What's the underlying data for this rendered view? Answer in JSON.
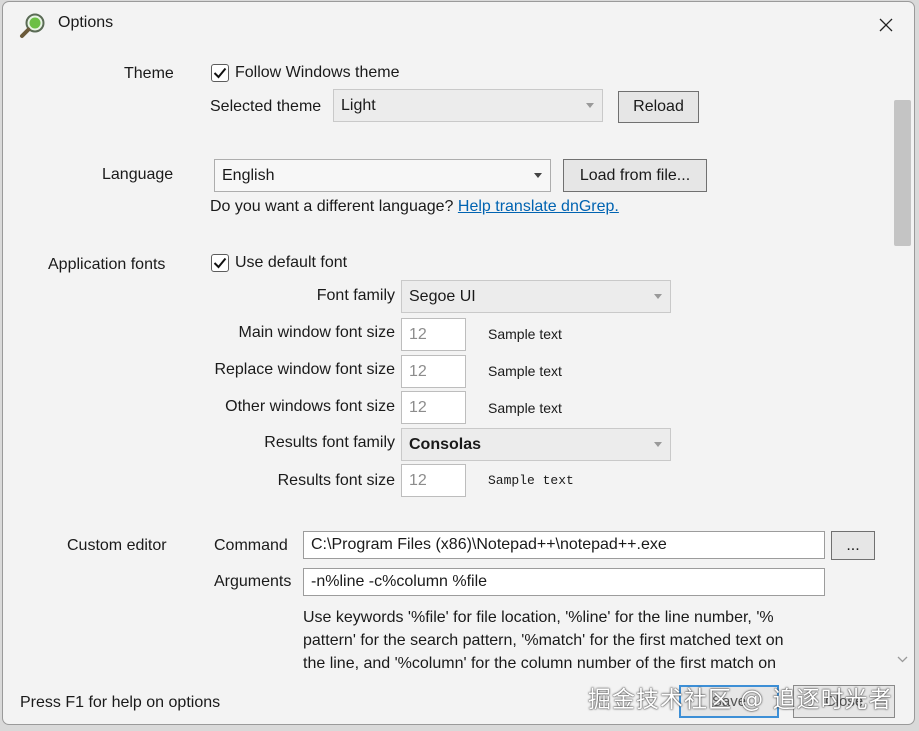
{
  "window": {
    "title": "Options",
    "app_icon": "magnifier-icon",
    "close_icon": "close-icon"
  },
  "theme": {
    "label": "Theme",
    "follow_windows": {
      "label": "Follow Windows theme",
      "checked": true
    },
    "selected_label": "Selected theme",
    "selected_value": "Light",
    "reload_label": "Reload"
  },
  "language": {
    "label": "Language",
    "value": "English",
    "load_label": "Load from file...",
    "prompt": "Do you want a different language?",
    "help_link": "Help translate dnGrep."
  },
  "fonts": {
    "label": "Application fonts",
    "use_default": {
      "label": "Use default font",
      "checked": true
    },
    "family_label": "Font family",
    "family_value": "Segoe UI",
    "main_label": "Main window font size",
    "main_value": "12",
    "replace_label": "Replace window font size",
    "replace_value": "12",
    "other_label": "Other windows font size",
    "other_value": "12",
    "sample_text": "Sample text",
    "results_family_label": "Results font family",
    "results_family_value": "Consolas",
    "results_size_label": "Results font size",
    "results_size_value": "12"
  },
  "editor": {
    "label": "Custom editor",
    "command_label": "Command",
    "command_value": "C:\\Program Files (x86)\\Notepad++\\notepad++.exe",
    "browse_label": "...",
    "arguments_label": "Arguments",
    "arguments_value": "-n%line -c%column %file",
    "help_lines": [
      "Use keywords '%file' for file location, '%line' for the line number, '%",
      "pattern' for the search pattern, '%match' for the first matched text on",
      "the line, and '%column' for the column number of the first match on"
    ]
  },
  "footer": {
    "help_text": "Press F1 for help on options",
    "save_label": "Save",
    "close_label": "Close"
  },
  "watermark": "掘金技术社区 @ 追逐时光者",
  "colors": {
    "link": "#0063b1",
    "default_button_border": "#3d8fd6",
    "window_bg": "#f3f3f3"
  }
}
